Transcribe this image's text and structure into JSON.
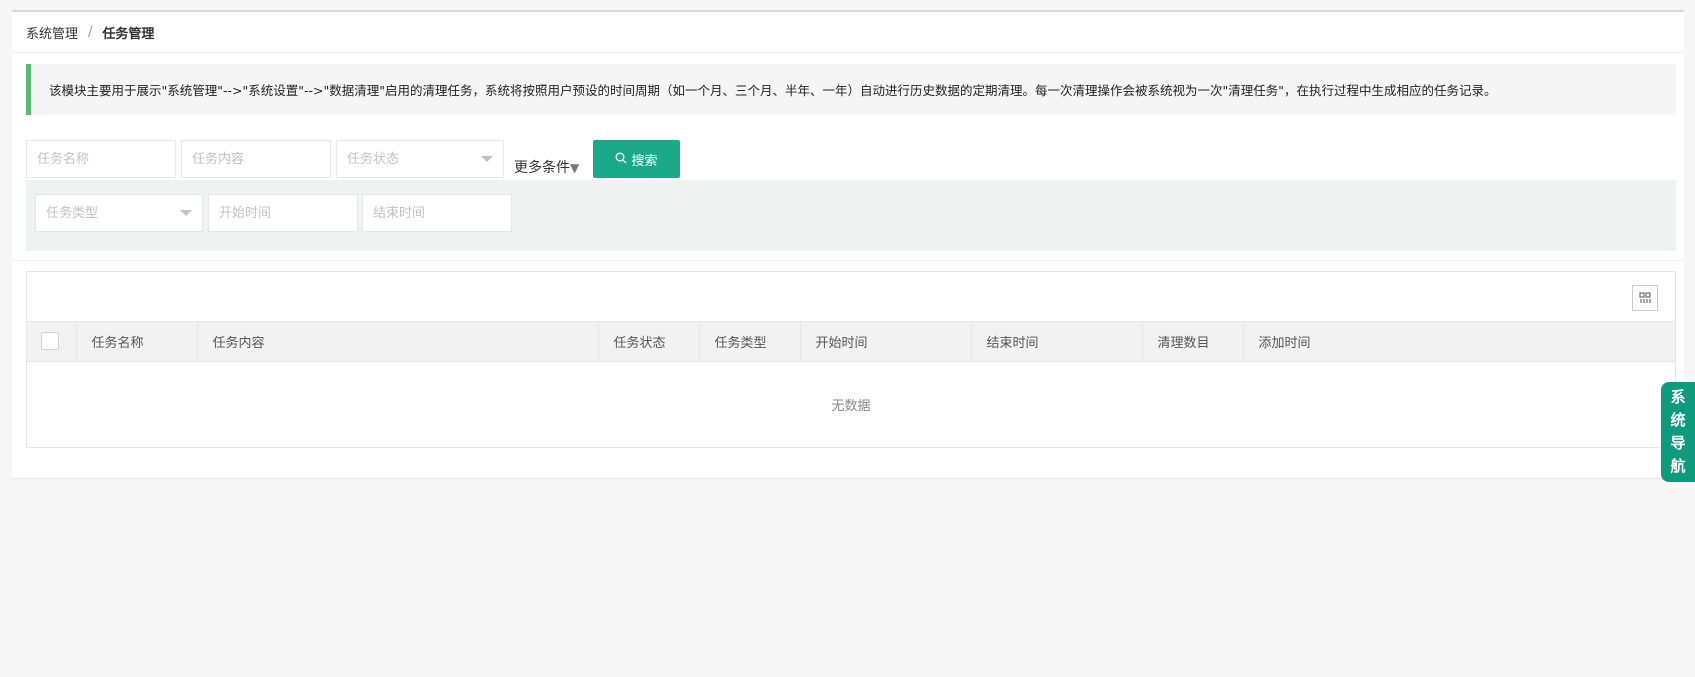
{
  "breadcrumb": {
    "parent": "系统管理",
    "separator": "/",
    "current": "任务管理"
  },
  "notice": {
    "text": "该模块主要用于展示\"系统管理\"-->\"系统设置\"-->\"数据清理\"启用的清理任务，系统将按照用户预设的时间周期（如一个月、三个月、半年、一年）自动进行历史数据的定期清理。每一次清理操作会被系统视为一次\"清理任务\"，在执行过程中生成相应的任务记录。"
  },
  "filters": {
    "task_name_placeholder": "任务名称",
    "task_content_placeholder": "任务内容",
    "task_status_placeholder": "任务状态",
    "more_label": "更多条件",
    "more_icon": "triangle-down",
    "search_label": "搜索",
    "search_icon": "magnifier",
    "task_type_placeholder": "任务类型",
    "start_time_placeholder": "开始时间",
    "end_time_placeholder": "结束时间"
  },
  "table": {
    "columns": [
      "任务名称",
      "任务内容",
      "任务状态",
      "任务类型",
      "开始时间",
      "结束时间",
      "清理数目",
      "添加时间"
    ],
    "empty_text": "无数据",
    "toolbar_icon": "columns-grid-icon"
  },
  "side_nav": {
    "chars": [
      "系",
      "统",
      "导",
      "航"
    ]
  },
  "colors": {
    "accent": "#1aaa8a",
    "notice_border": "#5fb878",
    "side_nav": "#0e9a7c"
  }
}
